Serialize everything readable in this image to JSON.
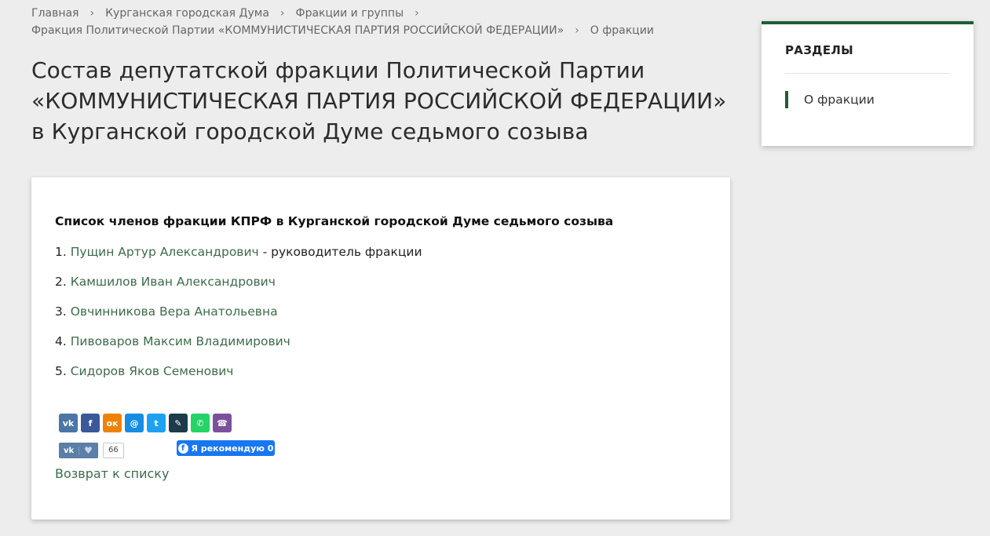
{
  "breadcrumb": {
    "items": [
      "Главная",
      "Курганская городская Дума",
      "Фракции и группы",
      "Фракция Политической Партии «КОММУНИСТИЧЕСКАЯ ПАРТИЯ РОССИЙСКОЙ ФЕДЕРАЦИИ»",
      "О фракции"
    ],
    "separator": "›"
  },
  "page": {
    "title": "Состав депутатской фракции Политической Партии «КОММУНИСТИЧЕСКАЯ ПАРТИЯ РОССИЙСКОЙ ФЕДЕРАЦИИ» в Курганской городской Думе седьмого созыва"
  },
  "content": {
    "list_heading": "Список членов фракции КПРФ в Курганской городской Думе седьмого созыва",
    "members": [
      {
        "num": "1.",
        "name": "Пущин Артур Александрович",
        "role": " - руководитель фракции"
      },
      {
        "num": "2.",
        "name": "Камшилов Иван Александрович",
        "role": ""
      },
      {
        "num": "3.",
        "name": "Овчинникова Вера Анатольевна",
        "role": ""
      },
      {
        "num": "4.",
        "name": "Пивоваров Максим Владимирович",
        "role": ""
      },
      {
        "num": "5.",
        "name": "Сидоров Яков Семенович",
        "role": ""
      }
    ],
    "share_buttons": [
      {
        "icon": "vk-icon",
        "glyph": "vk",
        "color": "#4a76a8"
      },
      {
        "icon": "facebook-icon",
        "glyph": "f",
        "color": "#3b5998"
      },
      {
        "icon": "odnoklassniki-icon",
        "glyph": "ок",
        "color": "#ee8208"
      },
      {
        "icon": "moimir-icon",
        "glyph": "@",
        "color": "#168de2"
      },
      {
        "icon": "twitter-icon",
        "glyph": "t",
        "color": "#1da1f2"
      },
      {
        "icon": "livejournal-icon",
        "glyph": "✎",
        "color": "#1d3b4a"
      },
      {
        "icon": "whatsapp-icon",
        "glyph": "✆",
        "color": "#25d366"
      },
      {
        "icon": "viber-icon",
        "glyph": "☎",
        "color": "#7b519d"
      }
    ],
    "vk_like": {
      "label": "vk",
      "count": "66"
    },
    "fb_recommend": {
      "label": "Я рекомендую 0"
    },
    "back_link": "Возврат к списку"
  },
  "sidebar": {
    "title": "РАЗДЕЛЫ",
    "items": [
      "О фракции"
    ]
  },
  "colors": {
    "accent": "#1f5e35",
    "link": "#3d6b4b",
    "background": "#ededed"
  }
}
